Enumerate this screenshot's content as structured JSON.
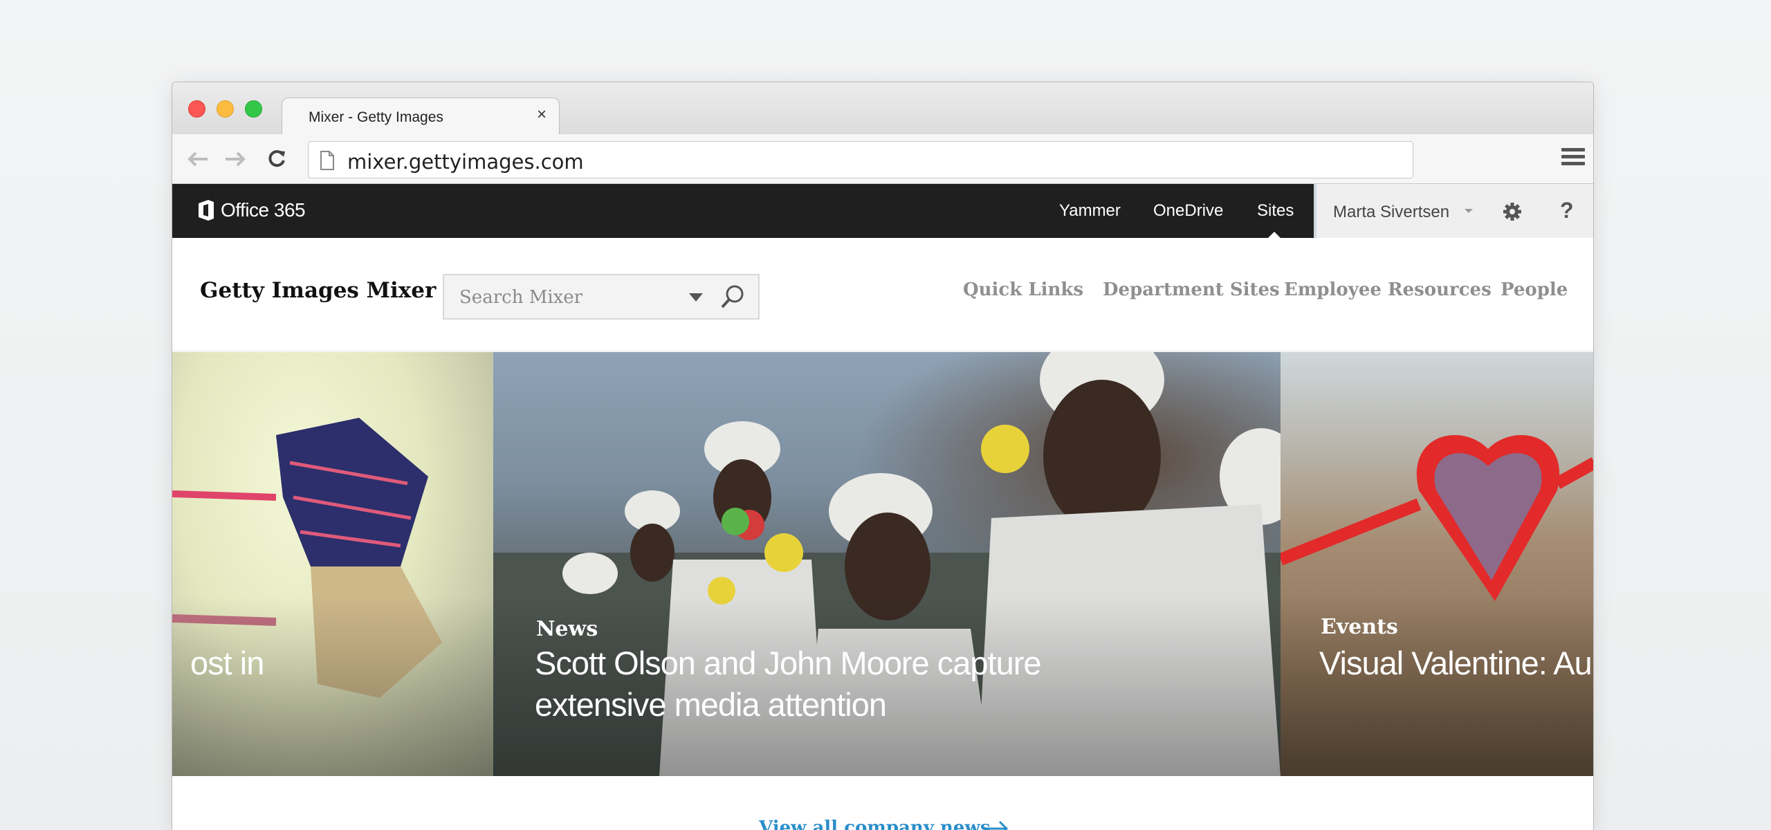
{
  "browser": {
    "tab_title": "Mixer - Getty Images",
    "tab_close": "×",
    "url": "mixer.gettyimages.com"
  },
  "o365": {
    "logo_text": "Office 365",
    "nav": [
      "Yammer",
      "OneDrive",
      "Sites"
    ],
    "active_nav": "Sites",
    "user_name": "Marta Sivertsen",
    "help": "?"
  },
  "site": {
    "title": "Getty Images Mixer",
    "search_placeholder": "Search Mixer",
    "nav": [
      "Quick Links",
      "Department Sites",
      "Employee Resources",
      "People"
    ]
  },
  "carousel": {
    "slides": [
      {
        "category": "",
        "title": "ost in"
      },
      {
        "category": "News",
        "title_line1": "Scott Olson and John Moore capture",
        "title_line2": "extensive media attention"
      },
      {
        "category": "Events",
        "title": "Visual Valentine: Au"
      }
    ]
  },
  "footer": {
    "view_all": "View all company news"
  },
  "colors": {
    "o365_bar": "#1f1f1f",
    "link": "#2a8ec9",
    "nav_gray": "#8f8f8f"
  }
}
